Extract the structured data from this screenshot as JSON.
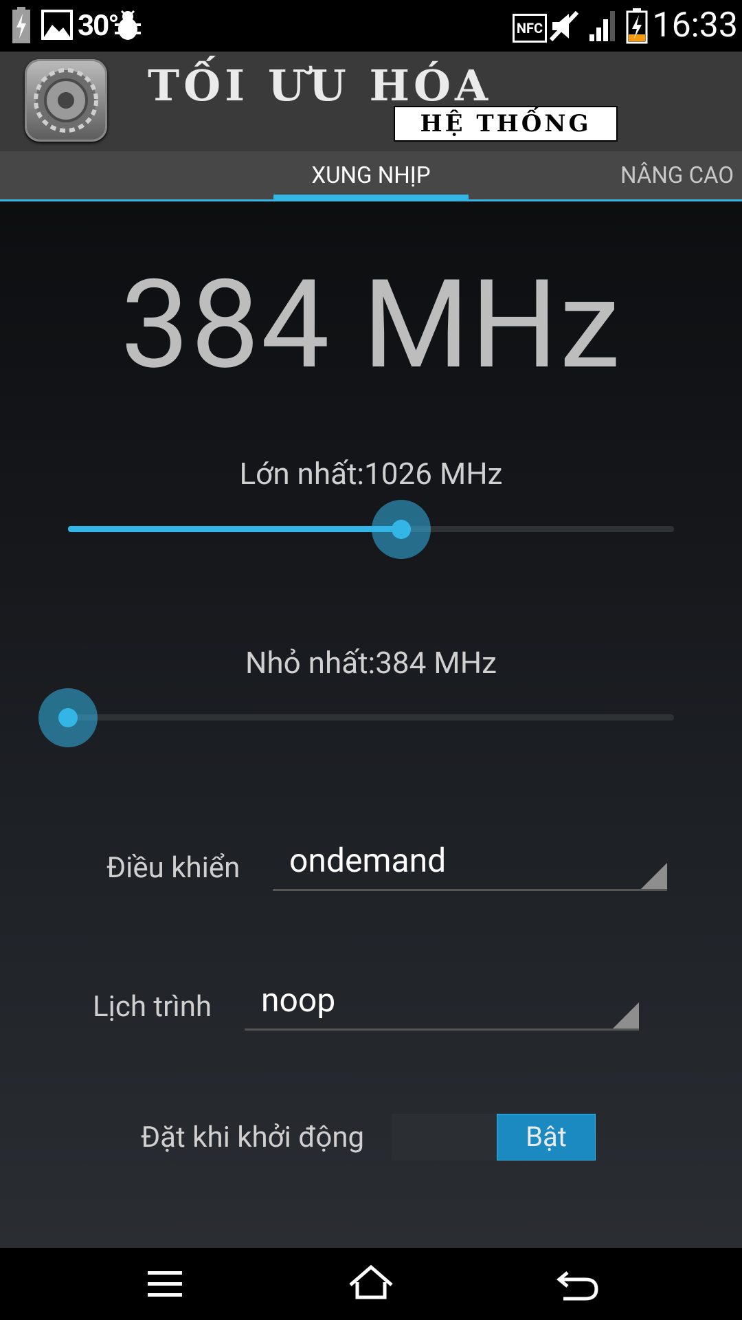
{
  "status_bar": {
    "temperature": "30°",
    "nfc": "NFC",
    "time": "16:33",
    "icons": [
      "battery-charging-icon",
      "image-icon",
      "bug-icon",
      "nfc-icon",
      "mute-icon",
      "signal-icon",
      "battery-icon"
    ]
  },
  "header": {
    "title": "TỐI ƯU HÓA",
    "subtitle": "HỆ THỐNG"
  },
  "tabs": {
    "active": "XUNG NHỊP",
    "next": "NÂNG CAO"
  },
  "main": {
    "current_frequency": "384 MHz",
    "max_label": "Lớn nhất:1026 MHz",
    "max_slider_fraction": 0.55,
    "min_label": "Nhỏ nhất:384 MHz",
    "min_slider_fraction": 0.0,
    "governor_label": "Điều khiển",
    "governor_value": "ondemand",
    "scheduler_label": "Lịch trình",
    "scheduler_value": "noop",
    "boot_label": "Đặt khi khởi động",
    "boot_toggle": "Bật"
  },
  "colors": {
    "accent": "#33b5e5",
    "toggle_on": "#1a8ac0"
  }
}
